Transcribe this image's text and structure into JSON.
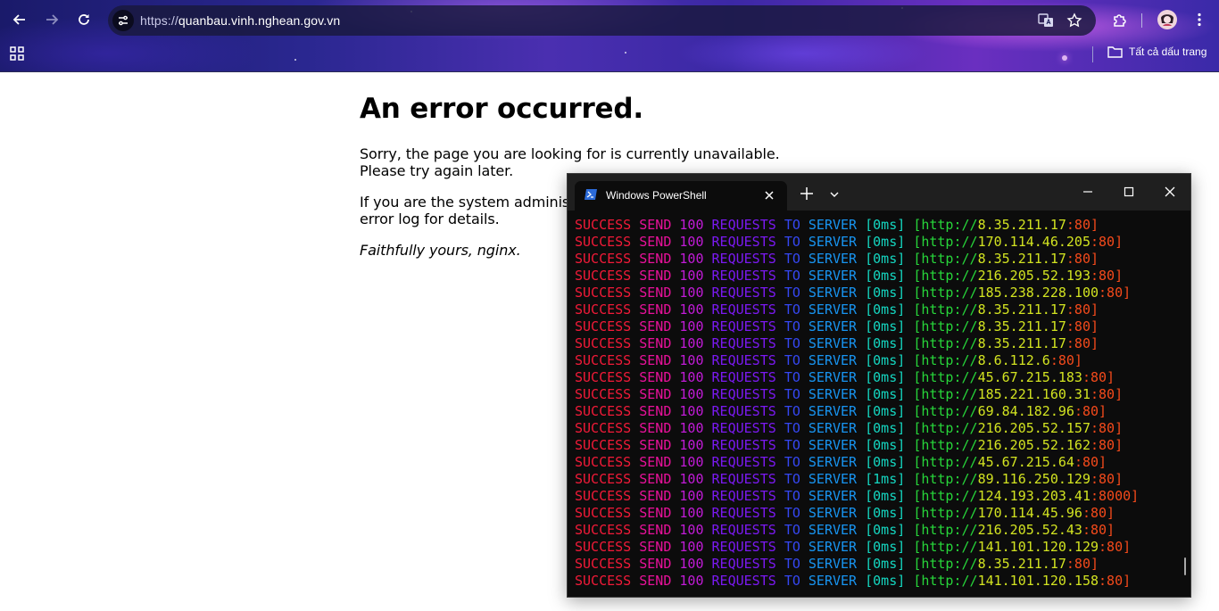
{
  "browser": {
    "url_scheme": "https://",
    "url_host": "quanbau.vinh.nghean.gov.vn",
    "bookmarks_label": "Tất cả dấu trang",
    "icons": [
      "back-arrow-icon",
      "forward-arrow-icon",
      "reload-icon",
      "site-info-icon",
      "translate-icon",
      "bookmark-star-icon",
      "extensions-icon",
      "profile-avatar",
      "menu-kebab-icon",
      "apps-grid-icon",
      "folder-icon"
    ]
  },
  "page": {
    "title": "An error occurred.",
    "para1_line1": "Sorry, the page you are looking for is currently unavailable.",
    "para1_line2": "Please try again later.",
    "para2_line1": "If you are the system administrator of this resource then you should check the",
    "para2_line2": "error log for details.",
    "signature": "Faithfully yours, nginx."
  },
  "powershell": {
    "tab_title": "Windows PowerShell",
    "icons": [
      "powershell-icon",
      "close-tab-icon",
      "new-tab-icon",
      "dropdown-chevron-icon",
      "minimize-icon",
      "maximize-icon",
      "close-window-icon"
    ],
    "colors": {
      "success": "#f21a38",
      "send": "#e8119a",
      "count": "#c21bd8",
      "requests": "#7b19f2",
      "to": "#3547f2",
      "server": "#1894f0",
      "time": "#14d6c0",
      "url": "#27d63a",
      "ip": "#d2e321",
      "port": "#f44a1b"
    },
    "lines": [
      {
        "success": "SUCCESS",
        "send": "SEND",
        "count": "100",
        "requests": "REQUESTS",
        "to": "TO",
        "server": "SERVER",
        "time": "[0ms]",
        "proto": "[http://",
        "host": "8.35.211.17",
        "port": ":80]"
      },
      {
        "success": "SUCCESS",
        "send": "SEND",
        "count": "100",
        "requests": "REQUESTS",
        "to": "TO",
        "server": "SERVER",
        "time": "[0ms]",
        "proto": "[http://",
        "host": "170.114.46.205",
        "port": ":80]"
      },
      {
        "success": "SUCCESS",
        "send": "SEND",
        "count": "100",
        "requests": "REQUESTS",
        "to": "TO",
        "server": "SERVER",
        "time": "[0ms]",
        "proto": "[http://",
        "host": "8.35.211.17",
        "port": ":80]"
      },
      {
        "success": "SUCCESS",
        "send": "SEND",
        "count": "100",
        "requests": "REQUESTS",
        "to": "TO",
        "server": "SERVER",
        "time": "[0ms]",
        "proto": "[http://",
        "host": "216.205.52.193",
        "port": ":80]"
      },
      {
        "success": "SUCCESS",
        "send": "SEND",
        "count": "100",
        "requests": "REQUESTS",
        "to": "TO",
        "server": "SERVER",
        "time": "[0ms]",
        "proto": "[http://",
        "host": "185.238.228.100",
        "port": ":80]"
      },
      {
        "success": "SUCCESS",
        "send": "SEND",
        "count": "100",
        "requests": "REQUESTS",
        "to": "TO",
        "server": "SERVER",
        "time": "[0ms]",
        "proto": "[http://",
        "host": "8.35.211.17",
        "port": ":80]"
      },
      {
        "success": "SUCCESS",
        "send": "SEND",
        "count": "100",
        "requests": "REQUESTS",
        "to": "TO",
        "server": "SERVER",
        "time": "[0ms]",
        "proto": "[http://",
        "host": "8.35.211.17",
        "port": ":80]"
      },
      {
        "success": "SUCCESS",
        "send": "SEND",
        "count": "100",
        "requests": "REQUESTS",
        "to": "TO",
        "server": "SERVER",
        "time": "[0ms]",
        "proto": "[http://",
        "host": "8.35.211.17",
        "port": ":80]"
      },
      {
        "success": "SUCCESS",
        "send": "SEND",
        "count": "100",
        "requests": "REQUESTS",
        "to": "TO",
        "server": "SERVER",
        "time": "[0ms]",
        "proto": "[http://",
        "host": "8.6.112.6",
        "port": ":80]"
      },
      {
        "success": "SUCCESS",
        "send": "SEND",
        "count": "100",
        "requests": "REQUESTS",
        "to": "TO",
        "server": "SERVER",
        "time": "[0ms]",
        "proto": "[http://",
        "host": "45.67.215.183",
        "port": ":80]"
      },
      {
        "success": "SUCCESS",
        "send": "SEND",
        "count": "100",
        "requests": "REQUESTS",
        "to": "TO",
        "server": "SERVER",
        "time": "[0ms]",
        "proto": "[http://",
        "host": "185.221.160.31",
        "port": ":80]"
      },
      {
        "success": "SUCCESS",
        "send": "SEND",
        "count": "100",
        "requests": "REQUESTS",
        "to": "TO",
        "server": "SERVER",
        "time": "[0ms]",
        "proto": "[http://",
        "host": "69.84.182.96",
        "port": ":80]"
      },
      {
        "success": "SUCCESS",
        "send": "SEND",
        "count": "100",
        "requests": "REQUESTS",
        "to": "TO",
        "server": "SERVER",
        "time": "[0ms]",
        "proto": "[http://",
        "host": "216.205.52.157",
        "port": ":80]"
      },
      {
        "success": "SUCCESS",
        "send": "SEND",
        "count": "100",
        "requests": "REQUESTS",
        "to": "TO",
        "server": "SERVER",
        "time": "[0ms]",
        "proto": "[http://",
        "host": "216.205.52.162",
        "port": ":80]"
      },
      {
        "success": "SUCCESS",
        "send": "SEND",
        "count": "100",
        "requests": "REQUESTS",
        "to": "TO",
        "server": "SERVER",
        "time": "[0ms]",
        "proto": "[http://",
        "host": "45.67.215.64",
        "port": ":80]"
      },
      {
        "success": "SUCCESS",
        "send": "SEND",
        "count": "100",
        "requests": "REQUESTS",
        "to": "TO",
        "server": "SERVER",
        "time": "[1ms]",
        "proto": "[http://",
        "host": "89.116.250.129",
        "port": ":80]"
      },
      {
        "success": "SUCCESS",
        "send": "SEND",
        "count": "100",
        "requests": "REQUESTS",
        "to": "TO",
        "server": "SERVER",
        "time": "[0ms]",
        "proto": "[http://",
        "host": "124.193.203.41",
        "port": ":8000]"
      },
      {
        "success": "SUCCESS",
        "send": "SEND",
        "count": "100",
        "requests": "REQUESTS",
        "to": "TO",
        "server": "SERVER",
        "time": "[0ms]",
        "proto": "[http://",
        "host": "170.114.45.96",
        "port": ":80]"
      },
      {
        "success": "SUCCESS",
        "send": "SEND",
        "count": "100",
        "requests": "REQUESTS",
        "to": "TO",
        "server": "SERVER",
        "time": "[0ms]",
        "proto": "[http://",
        "host": "216.205.52.43",
        "port": ":80]"
      },
      {
        "success": "SUCCESS",
        "send": "SEND",
        "count": "100",
        "requests": "REQUESTS",
        "to": "TO",
        "server": "SERVER",
        "time": "[0ms]",
        "proto": "[http://",
        "host": "141.101.120.129",
        "port": ":80]"
      },
      {
        "success": "SUCCESS",
        "send": "SEND",
        "count": "100",
        "requests": "REQUESTS",
        "to": "TO",
        "server": "SERVER",
        "time": "[0ms]",
        "proto": "[http://",
        "host": "8.35.211.17",
        "port": ":80]"
      },
      {
        "success": "SUCCESS",
        "send": "SEND",
        "count": "100",
        "requests": "REQUESTS",
        "to": "TO",
        "server": "SERVER",
        "time": "[0ms]",
        "proto": "[http://",
        "host": "141.101.120.158",
        "port": ":80]"
      }
    ]
  }
}
